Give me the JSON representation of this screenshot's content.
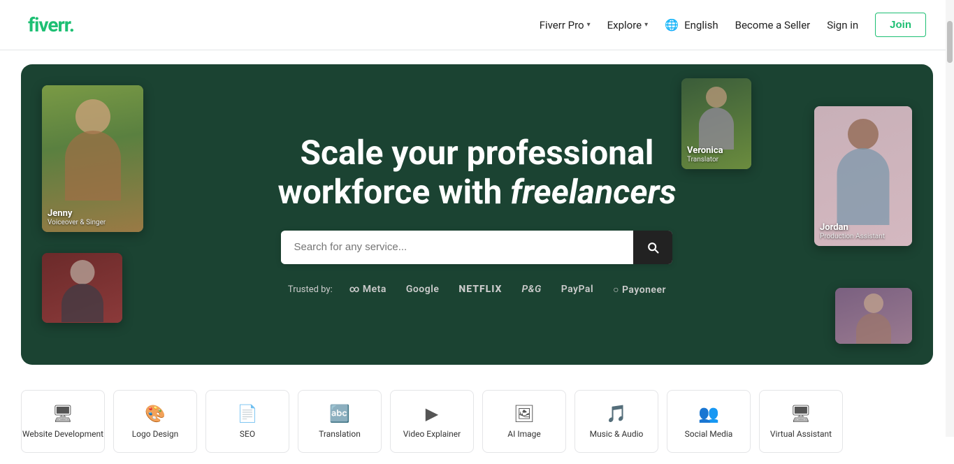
{
  "header": {
    "logo_text": "fiverr",
    "logo_dot": ".",
    "nav": {
      "fiverr_pro_label": "Fiverr Pro",
      "explore_label": "Explore",
      "language_label": "English",
      "become_seller_label": "Become a Seller",
      "sign_in_label": "Sign in",
      "join_label": "Join"
    }
  },
  "hero": {
    "title_line1": "Scale your professional",
    "title_line2": "workforce with ",
    "title_italic": "freelancers",
    "search_placeholder": "Search for any service...",
    "trusted_by_label": "Trusted by:",
    "trusted_logos": [
      {
        "name": "meta",
        "display": "∞ Meta"
      },
      {
        "name": "google",
        "display": "Google"
      },
      {
        "name": "netflix",
        "display": "NETFLIX"
      },
      {
        "name": "pg",
        "display": "P&G"
      },
      {
        "name": "paypal",
        "display": "PayPal"
      },
      {
        "name": "payoneer",
        "display": "○ Payoneer"
      }
    ],
    "freelancers": [
      {
        "id": "jenny",
        "name": "Jenny",
        "role": "Voiceover & Singer",
        "position": "top-left"
      },
      {
        "id": "veronica",
        "name": "Veronica",
        "role": "Translator",
        "position": "top-right-inner"
      },
      {
        "id": "jordan",
        "name": "Jordan",
        "role": "Production Assistant",
        "position": "top-right"
      },
      {
        "id": "person4",
        "name": "",
        "role": "",
        "position": "bottom-left"
      },
      {
        "id": "person5",
        "name": "",
        "role": "",
        "position": "bottom-right"
      }
    ]
  },
  "categories": [
    {
      "id": "website-dev",
      "icon": "🖥",
      "label": "Website Development"
    },
    {
      "id": "logo-design",
      "icon": "🎨",
      "label": "Logo Design"
    },
    {
      "id": "seo",
      "icon": "📄",
      "label": "SEO"
    },
    {
      "id": "translation",
      "icon": "🔤",
      "label": "Translation"
    },
    {
      "id": "video-explainer",
      "icon": "▶",
      "label": "Video Explainer"
    },
    {
      "id": "ai-image",
      "icon": "🖼",
      "label": "AI Image"
    },
    {
      "id": "music-audio",
      "icon": "🎵",
      "label": "Music & Audio"
    },
    {
      "id": "social-media",
      "icon": "👥",
      "label": "Social Media"
    },
    {
      "id": "virtual-assistant",
      "icon": "🖥",
      "label": "Virtual Assistant"
    }
  ]
}
